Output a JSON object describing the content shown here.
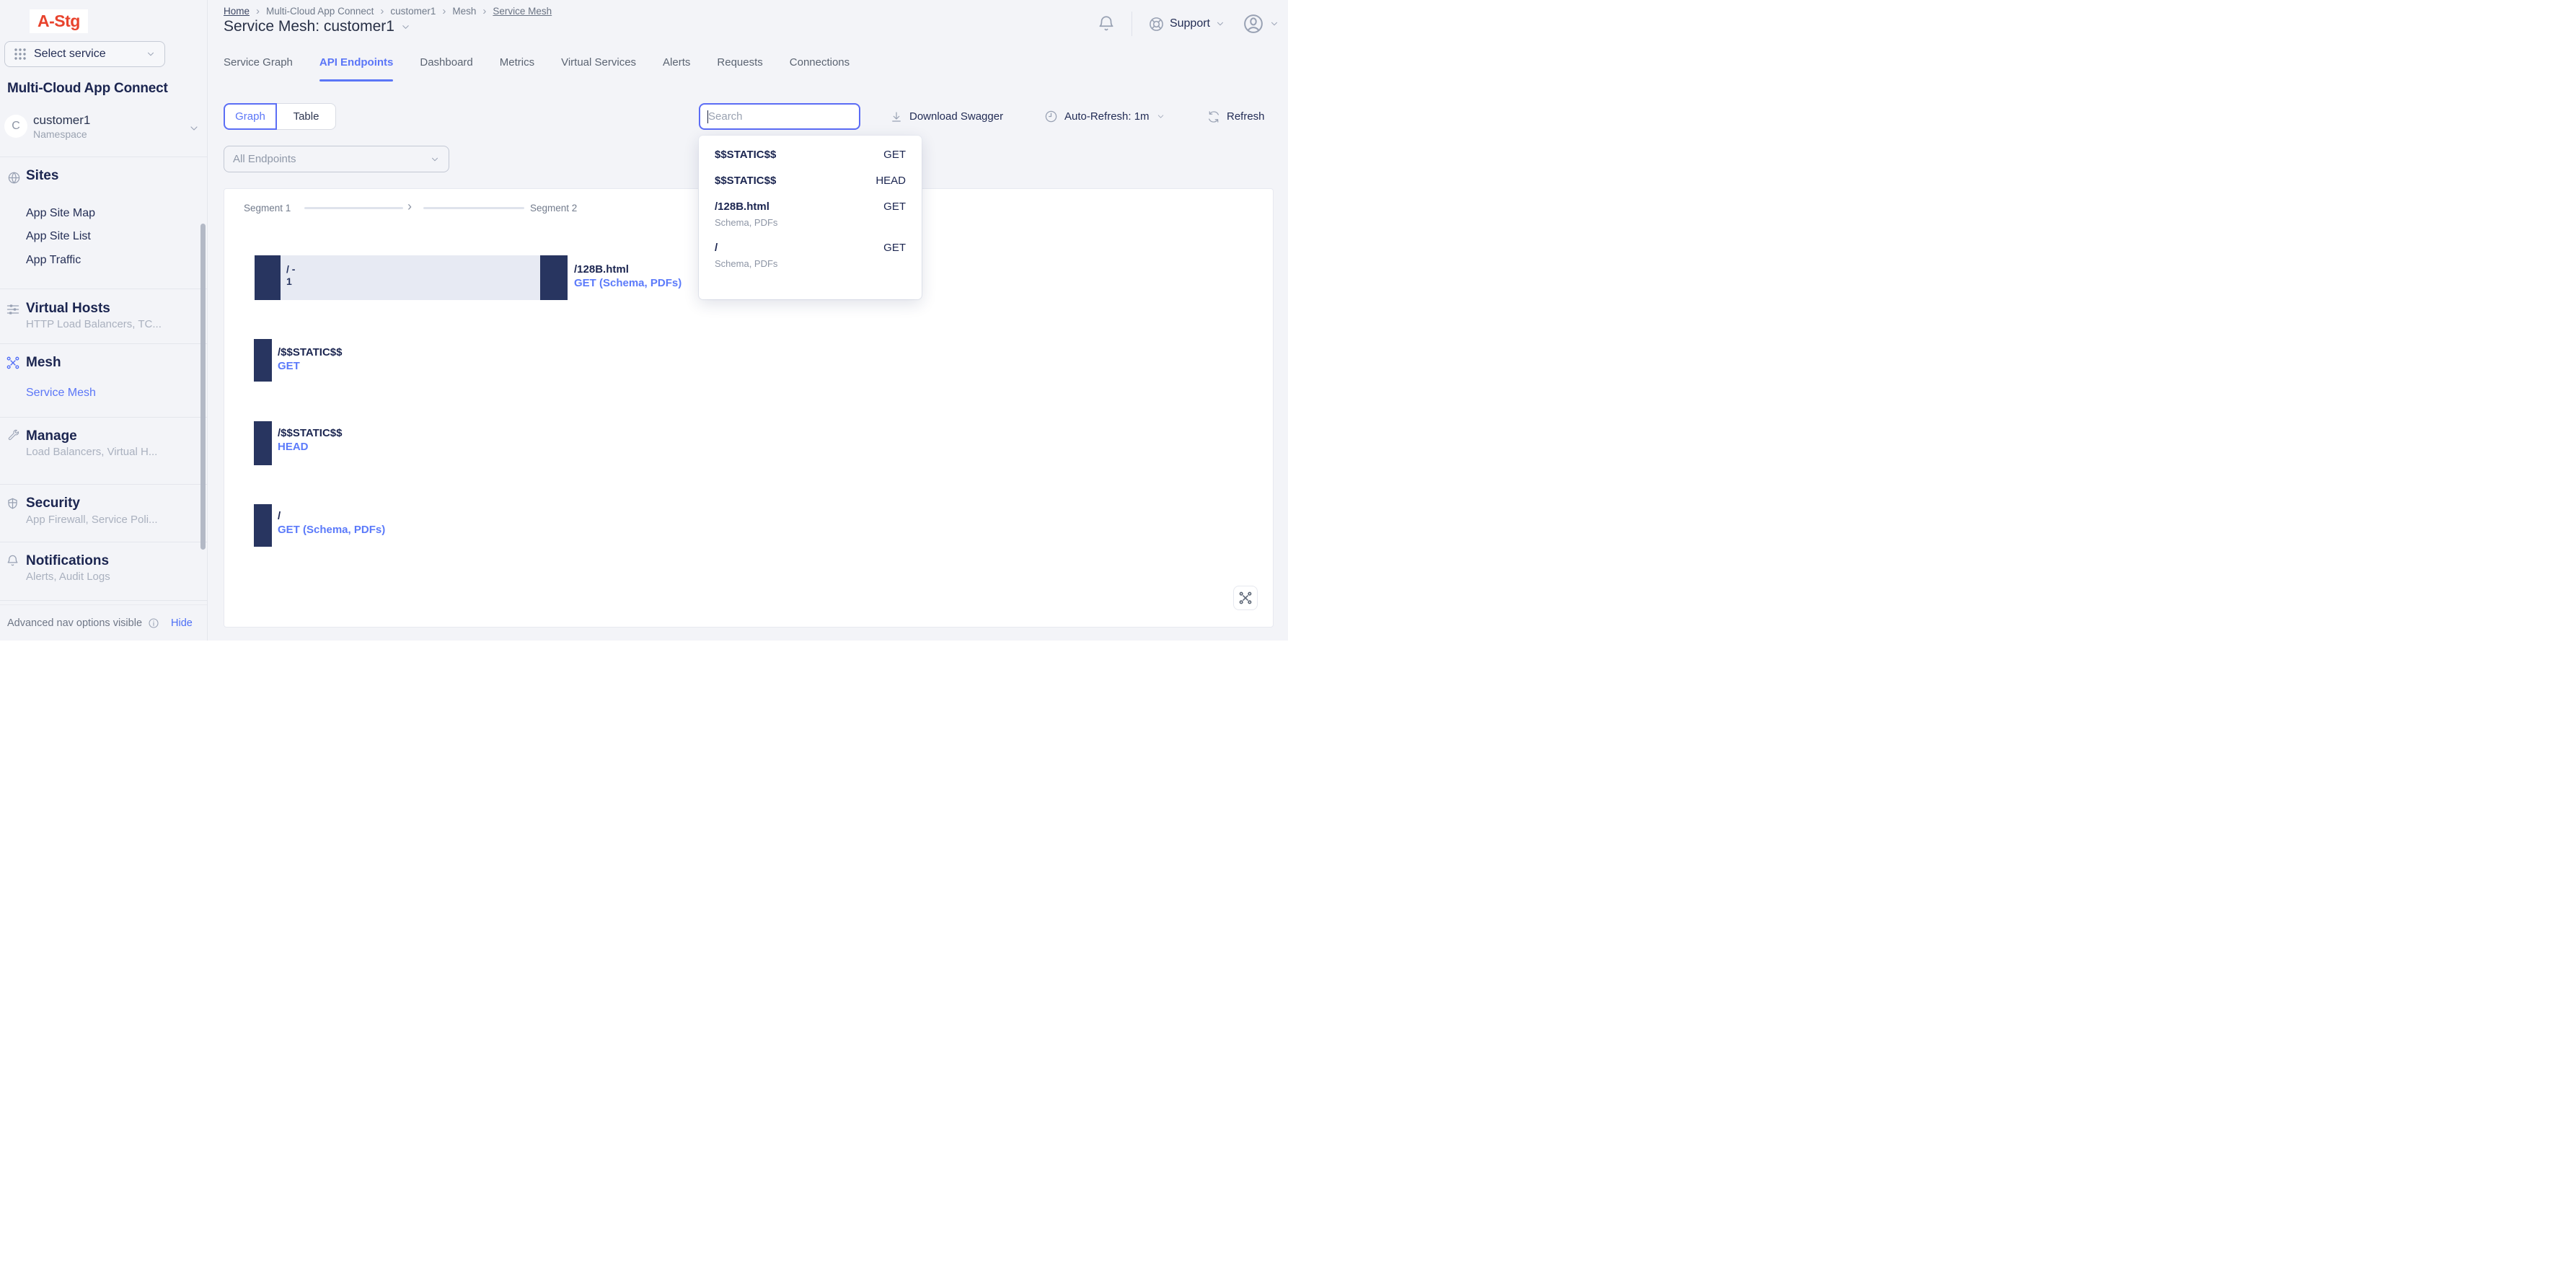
{
  "logo": {
    "text": "A-Stg"
  },
  "sidebar": {
    "service_selector": {
      "label": "Select service"
    },
    "title": "Multi-Cloud App Connect",
    "namespace": {
      "avatar_letter": "C",
      "name": "customer1",
      "type_label": "Namespace"
    },
    "sections": [
      {
        "label": "Sites",
        "items": [
          "App Site Map",
          "App Site List",
          "App Traffic"
        ]
      },
      {
        "label": "Virtual Hosts",
        "subtitle": "HTTP Load Balancers, TC..."
      },
      {
        "label": "Mesh",
        "items": [
          "Service Mesh"
        ]
      },
      {
        "label": "Manage",
        "subtitle": "Load Balancers, Virtual H..."
      },
      {
        "label": "Security",
        "subtitle": "App Firewall, Service Poli..."
      },
      {
        "label": "Notifications",
        "subtitle": "Alerts, Audit Logs"
      }
    ],
    "footer": {
      "status": "Advanced nav options visible",
      "action": "Hide"
    }
  },
  "topbar": {
    "support_label": "Support"
  },
  "breadcrumb": {
    "items": [
      "Home",
      "Multi-Cloud App Connect",
      "customer1",
      "Mesh",
      "Service Mesh"
    ]
  },
  "page": {
    "title": "Service Mesh: customer1"
  },
  "tabs": {
    "active": "API Endpoints",
    "items": [
      {
        "label": "Service Graph"
      },
      {
        "label": "API Endpoints"
      },
      {
        "label": "Dashboard"
      },
      {
        "label": "Metrics"
      },
      {
        "label": "Virtual Services"
      },
      {
        "label": "Alerts"
      },
      {
        "label": "Requests"
      },
      {
        "label": "Connections"
      }
    ]
  },
  "toolbar": {
    "view_toggle": {
      "graph": "Graph",
      "table": "Table"
    },
    "endpoint_filter": "All Endpoints",
    "search_placeholder": "Search",
    "download_label": "Download Swagger",
    "auto_refresh_label": "Auto-Refresh: 1m",
    "refresh_label": "Refresh"
  },
  "search_results": [
    {
      "path": "$$STATIC$$",
      "method": "GET"
    },
    {
      "path": "$$STATIC$$",
      "method": "HEAD"
    },
    {
      "path": "/128B.html",
      "method": "GET",
      "subtitle": "Schema, PDFs"
    },
    {
      "path": "/",
      "method": "GET",
      "subtitle": "Schema, PDFs"
    }
  ],
  "graph": {
    "segments": [
      "Segment 1",
      "Segment 2"
    ],
    "edge_node": {
      "line1": "/ -",
      "line2": "1"
    },
    "rows": [
      {
        "endpoint": "/128B.html",
        "method": "GET (Schema, PDFs)"
      },
      {
        "endpoint": "/$$STATIC$$",
        "method": "GET"
      },
      {
        "endpoint": "/$$STATIC$$",
        "method": "HEAD"
      },
      {
        "endpoint": "/",
        "method": "GET (Schema, PDFs)"
      }
    ]
  },
  "colors": {
    "accent_blue": "#5b76f7",
    "method_blue": "#5b7afa",
    "node_navy": "#283560",
    "edge_band": "#e7eaf3",
    "logo_red": "#e8432d",
    "page_bg": "#f3f4f8"
  }
}
